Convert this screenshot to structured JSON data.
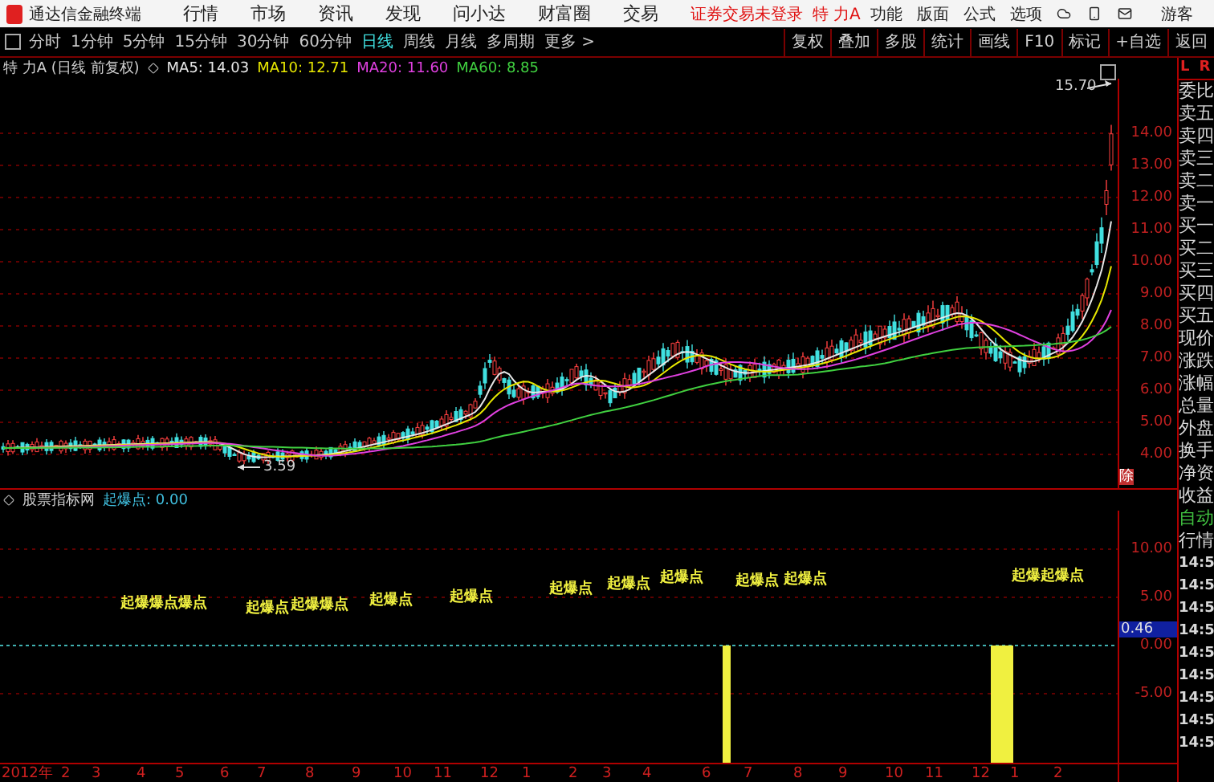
{
  "menu_bar": {
    "app_title": "通达信金融终端",
    "menus": [
      "行情",
      "市场",
      "资讯",
      "发现",
      "问小达",
      "财富圈",
      "交易"
    ],
    "login_status": "证券交易未登录",
    "stock_name": "特 力A",
    "functions": [
      "功能",
      "版面",
      "公式",
      "选项"
    ],
    "user": "游客"
  },
  "period_tabs": [
    {
      "label": "分时",
      "selected": false
    },
    {
      "label": "1分钟",
      "selected": false
    },
    {
      "label": "5分钟",
      "selected": false
    },
    {
      "label": "15分钟",
      "selected": false
    },
    {
      "label": "30分钟",
      "selected": false
    },
    {
      "label": "60分钟",
      "selected": false
    },
    {
      "label": "日线",
      "selected": true
    },
    {
      "label": "周线",
      "selected": false
    },
    {
      "label": "月线",
      "selected": false
    },
    {
      "label": "多周期",
      "selected": false
    },
    {
      "label": "更多 >",
      "selected": false
    }
  ],
  "chart_tools": [
    "复权",
    "叠加",
    "多股",
    "统计",
    "画线",
    "F10",
    "标记",
    "+自选",
    "返回"
  ],
  "chart_info": {
    "title": "特 力A (日线 前复权)",
    "averages": [
      {
        "label": "MA5: 14.03",
        "color": "#e8e8e8"
      },
      {
        "label": "MA10: 12.71",
        "color": "#e8e800"
      },
      {
        "label": "MA20: 11.60",
        "color": "#e040e0"
      },
      {
        "label": "MA60: 8.85",
        "color": "#40d040"
      }
    ]
  },
  "price_chart": {
    "high_label": "15.70",
    "low_label": "3.59",
    "ticks": [
      "14.00",
      "13.00",
      "12.00",
      "11.00",
      "10.00",
      "9.00",
      "8.00",
      "7.00",
      "6.00",
      "5.00",
      "4.00"
    ],
    "adjust_mark": "除"
  },
  "indicator": {
    "source": "股票指标网",
    "name": "起爆点",
    "value": ": 0.00",
    "ticks": [
      "10.00",
      "5.00",
      "0.00",
      "-5.00"
    ],
    "current": "0.46",
    "signals": [
      "起爆爆点爆点",
      "起爆点",
      "起爆爆点",
      "起爆点",
      "起爆点",
      "起爆点",
      "起爆点",
      "起爆点",
      "起爆点",
      "起爆点",
      "起爆起爆点"
    ]
  },
  "x_axis": [
    "2012年",
    "2",
    "3",
    "4",
    "5",
    "6",
    "7",
    "8",
    "9",
    "10",
    "11",
    "12",
    "1",
    "2",
    "3",
    "4",
    "6",
    "7",
    "8",
    "9",
    "10",
    "11",
    "12",
    "1",
    "2"
  ],
  "quote_panel": {
    "header": [
      "L",
      "R"
    ],
    "fields": [
      {
        "label": "委比",
        "kind": "field"
      },
      {
        "label": "卖五",
        "kind": "field"
      },
      {
        "label": "卖四",
        "kind": "field"
      },
      {
        "label": "卖三",
        "kind": "field"
      },
      {
        "label": "卖二",
        "kind": "field"
      },
      {
        "label": "卖一",
        "kind": "field"
      },
      {
        "label": "买一",
        "kind": "field"
      },
      {
        "label": "买二",
        "kind": "field"
      },
      {
        "label": "买三",
        "kind": "field"
      },
      {
        "label": "买四",
        "kind": "field"
      },
      {
        "label": "买五",
        "kind": "field"
      },
      {
        "label": "现价",
        "kind": "field"
      },
      {
        "label": "涨跌",
        "kind": "field"
      },
      {
        "label": "涨幅",
        "kind": "field"
      },
      {
        "label": "总量",
        "kind": "field"
      },
      {
        "label": "外盘",
        "kind": "field"
      },
      {
        "label": "换手",
        "kind": "field"
      },
      {
        "label": "净资",
        "kind": "field"
      },
      {
        "label": "收益",
        "kind": "field"
      },
      {
        "label": "自动",
        "kind": "mode"
      },
      {
        "label": "行情",
        "kind": "field"
      },
      {
        "label": "14:5",
        "kind": "time"
      },
      {
        "label": "14:5",
        "kind": "time"
      },
      {
        "label": "14:5",
        "kind": "time"
      },
      {
        "label": "14:5",
        "kind": "time"
      },
      {
        "label": "14:5",
        "kind": "time"
      },
      {
        "label": "14:5",
        "kind": "time"
      },
      {
        "label": "14:5",
        "kind": "time"
      },
      {
        "label": "14:5",
        "kind": "time"
      },
      {
        "label": "14:5",
        "kind": "time"
      }
    ]
  }
}
